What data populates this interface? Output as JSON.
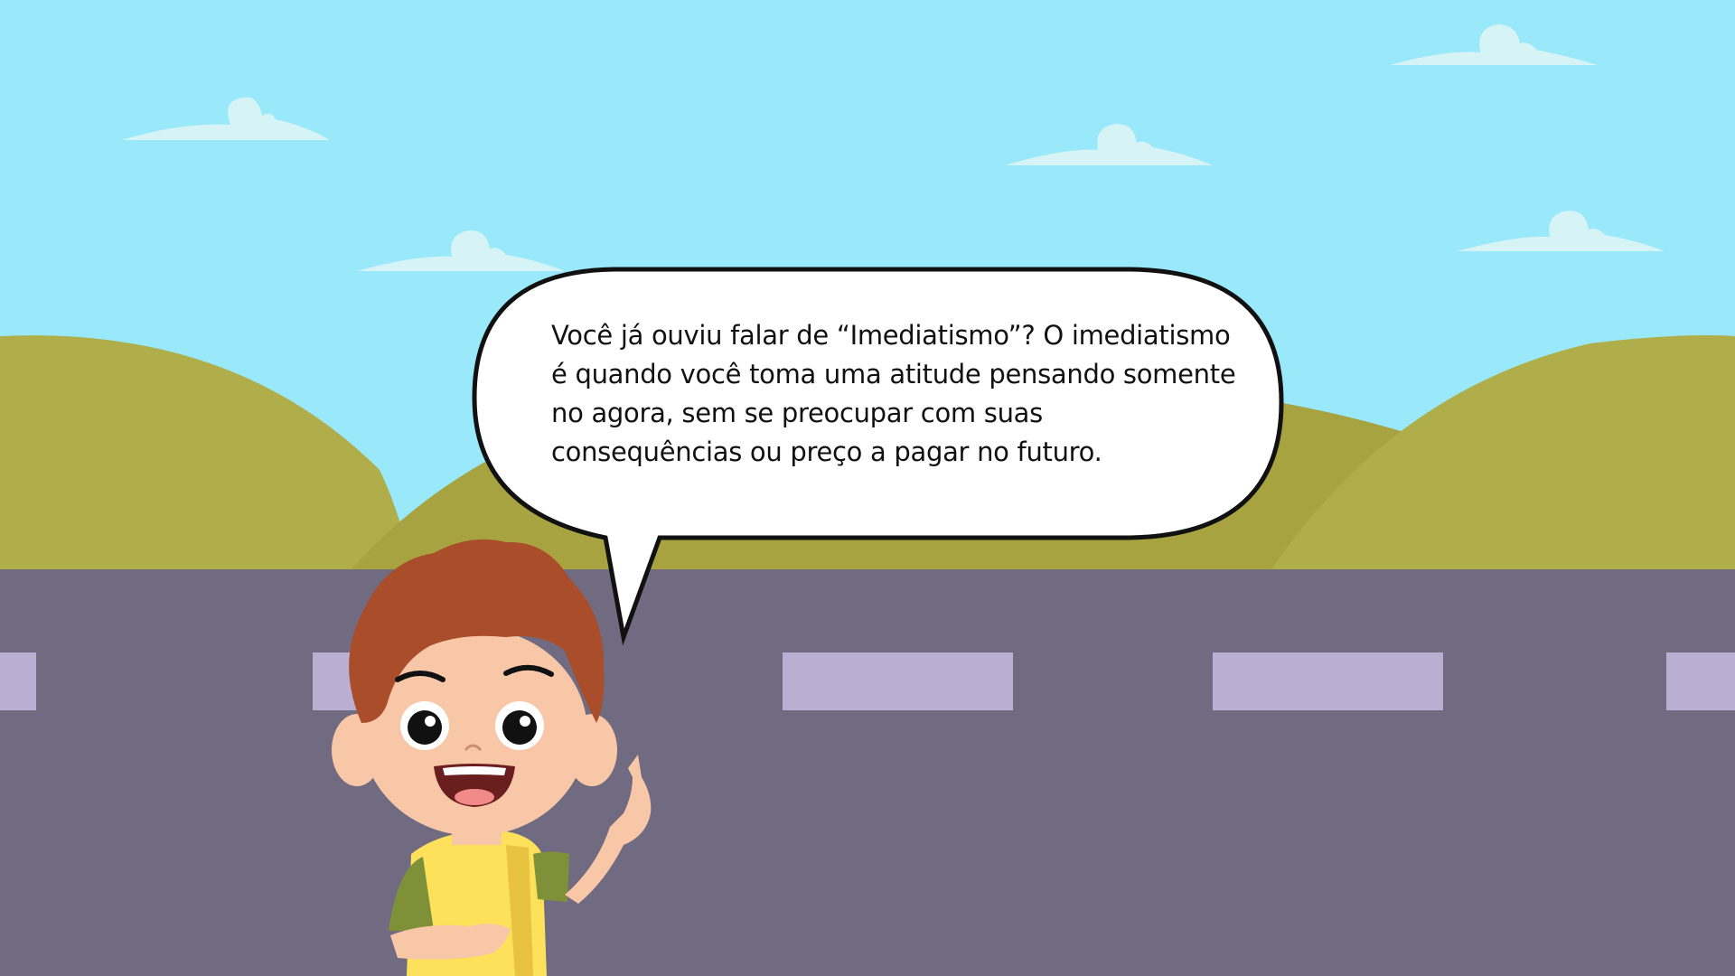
{
  "scene": {
    "sky_color": "#9AE9FB",
    "cloud_color": "#D6F3F6",
    "hill_color_light": "#AFAE4A",
    "hill_color_dark": "#A6A340",
    "road_color": "#716B82",
    "road_marking_color": "#BAAED3"
  },
  "speech_bubble": {
    "text": "Você já ouviu falar de “Imediatismo”? O imediatismo é quando você toma uma atitude pensando somente no agora, sem se preocupar com suas consequências ou preço a pagar no futuro.",
    "fill_color": "#FFFFFF",
    "border_color": "#111111"
  },
  "character": {
    "hair_color": "#A94D2A",
    "skin_color": "#F8C7A7",
    "shirt_color": "#FDE15A",
    "sleeve_color": "#7E9138"
  }
}
